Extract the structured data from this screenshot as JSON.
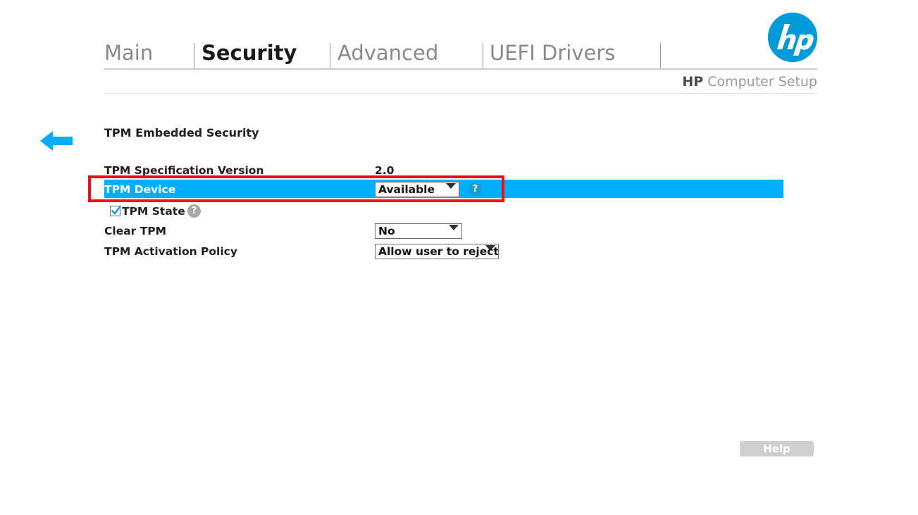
{
  "app": {
    "caption_bold": "HP",
    "caption_rest": " Computer Setup",
    "logo_text": "hp"
  },
  "tabs": [
    {
      "label": "Main",
      "active": false
    },
    {
      "label": "Security",
      "active": true
    },
    {
      "label": "Advanced",
      "active": false
    },
    {
      "label": "UEFI Drivers",
      "active": false
    }
  ],
  "content": {
    "section_heading": "TPM Embedded Security",
    "rows": [
      {
        "label": "TPM Specification Version",
        "value": "2.0",
        "type": "static"
      },
      {
        "label": "TPM Device",
        "value": "Available",
        "type": "select",
        "highlighted": true,
        "help": "?"
      },
      {
        "label": "TPM State",
        "type": "checkbox",
        "checked": true,
        "help": "?"
      },
      {
        "label": "Clear TPM",
        "value": "No",
        "type": "select"
      },
      {
        "label": "TPM Activation Policy",
        "value": "Allow user to reject",
        "type": "select"
      }
    ]
  },
  "footer": {
    "help_label": "Help"
  },
  "annotations": {
    "arrow": "left-arrow-annotation",
    "box": "red-highlight-box"
  },
  "colors": {
    "highlight_blue": "#00aeff",
    "annotation_red": "#ee1111",
    "hp_blue": "#0099da",
    "help_icon_blue": "#1b9ad6"
  }
}
